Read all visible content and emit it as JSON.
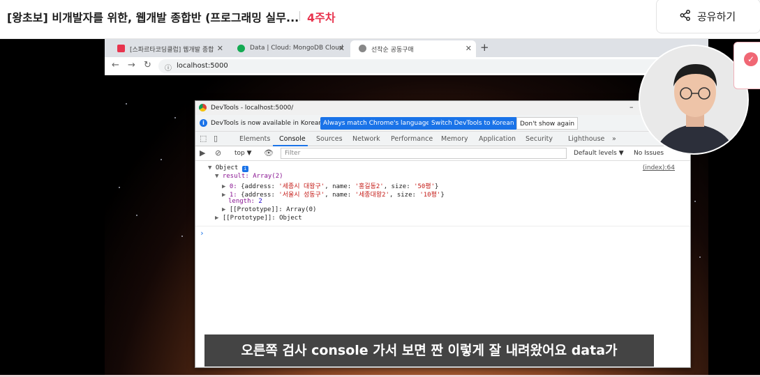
{
  "header": {
    "course_title": "[왕초보] 비개발자를 위한, 웹개발 종합반 (프로그래밍 실무...",
    "week": "4주차",
    "share_label": "공유하기"
  },
  "browser": {
    "tabs": [
      {
        "label": "[스파르타코딩클럽] 웹개발 종합",
        "fav_color": "#e8344e"
      },
      {
        "label": "Data | Cloud: MongoDB Cloud",
        "fav_color": "#13aa52"
      },
      {
        "label": "선착순 공동구매",
        "fav_color": "#888888"
      }
    ],
    "url": "localhost:5000"
  },
  "devtools": {
    "title": "DevTools - localhost:5000/",
    "infobar_message": "DevTools is now available in Korean!",
    "btn_match": "Always match Chrome's language",
    "btn_switch": "Switch DevTools to Korean",
    "btn_dismiss": "Don't show again",
    "panels": [
      "Elements",
      "Console",
      "Sources",
      "Network",
      "Performance",
      "Memory",
      "Application",
      "Security",
      "Lighthouse"
    ],
    "more": "»",
    "context": "top ▼",
    "filter_placeholder": "Filter",
    "default_levels": "Default levels ▼",
    "no_issues": "No Issues",
    "source_link": "(index):64",
    "console_lines": {
      "object": "Object",
      "result": "result: Array(2)",
      "item0_key": "0:",
      "item0_addr": "'세종시 대왕구'",
      "item0_name": "'홍길동2'",
      "item0_size": "'50평'",
      "item1_key": "1:",
      "item1_addr": "'서울시 성동구'",
      "item1_name": "'세종대왕2'",
      "item1_size": "'10평'",
      "length_key": "length:",
      "length_val": "2",
      "proto_array": "[[Prototype]]: Array(0)",
      "proto_object": "[[Prototype]]: Object"
    }
  },
  "subtitle": "오른쪽 검사 console 가서 보면 짠 이렇게 잘 내려왔어요 data가"
}
